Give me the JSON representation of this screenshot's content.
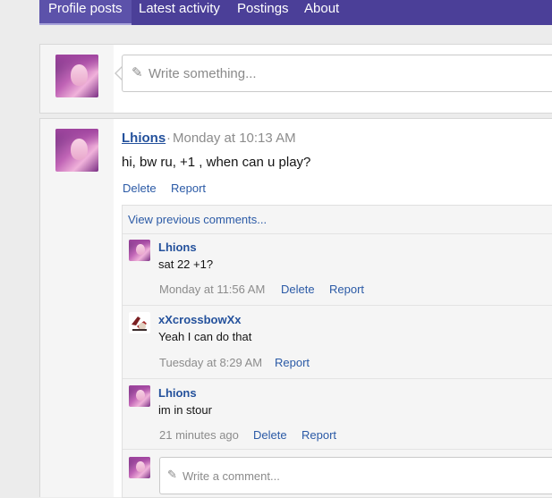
{
  "tabs": [
    {
      "label": "Profile posts"
    },
    {
      "label": "Latest activity"
    },
    {
      "label": "Postings"
    },
    {
      "label": "About"
    }
  ],
  "status_box": {
    "placeholder": "Write something..."
  },
  "post": {
    "author": "Lhions",
    "separator": "·",
    "time": "Monday at 10:13 AM",
    "text": "hi, bw ru, +1 , when can u play?",
    "delete_label": "Delete",
    "report_label": "Report"
  },
  "comments": {
    "view_previous": "View previous comments...",
    "items": [
      {
        "author": "Lhions",
        "text": "sat 22 +1?",
        "time": "Monday at 11:56 AM",
        "actions": [
          "Delete",
          "Report"
        ]
      },
      {
        "author": "xXcrossbowXx",
        "text": "Yeah I can do that",
        "time": "Tuesday at 8:29 AM",
        "actions": [
          "Report"
        ]
      },
      {
        "author": "Lhions",
        "text": "im in stour",
        "time": "21 minutes ago",
        "actions": [
          "Delete",
          "Report"
        ]
      }
    ],
    "reply_placeholder": "Write a comment..."
  },
  "icons": {
    "pencil": "pencil-icon"
  },
  "colors": {
    "nav": "#4b3f98",
    "link": "#2b5aa6",
    "username": "#24519c"
  }
}
